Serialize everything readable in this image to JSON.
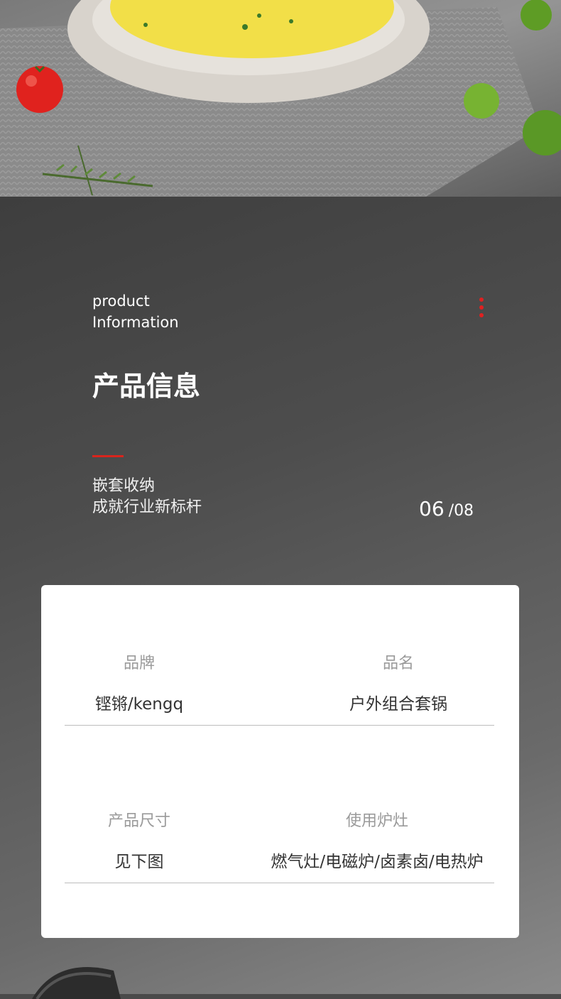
{
  "hero": {
    "image": "omelette-plate-photo",
    "colors": {
      "plate": "#dcd8d2",
      "omelette": "#f3e04a",
      "tomato": "#e0221e",
      "lime": "#6aa82a",
      "cloth": "#8c8c8c"
    }
  },
  "info": {
    "english_title_line1": "product",
    "english_title_line2": "Information",
    "chinese_title": "产品信息",
    "subtitle_line1": "嵌套收纳",
    "subtitle_line2": "成就行业新标杆",
    "page_current": "06",
    "page_separator": "/",
    "page_total": "08",
    "accent_color": "#d9241c"
  },
  "specs": [
    {
      "label": "品牌",
      "value": "铿锵/kengq"
    },
    {
      "label": "品名",
      "value": "户外组合套锅"
    },
    {
      "label": "产品尺寸",
      "value": "见下图"
    },
    {
      "label": "使用炉灶",
      "value": "燃气灶/电磁炉/卤素卤/电热炉"
    }
  ]
}
